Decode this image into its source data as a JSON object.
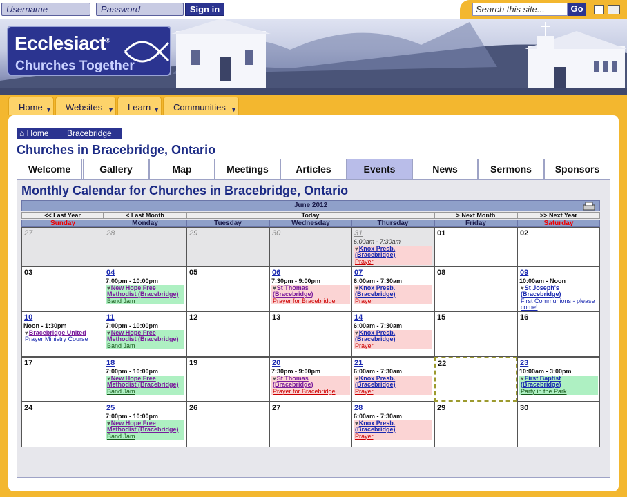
{
  "top": {
    "username_ph": "Username",
    "password_ph": "Password",
    "signin": "Sign in",
    "search_ph": "Search this site...",
    "go": "Go"
  },
  "logo": {
    "line1": "Ecclesiact",
    "reg": "®",
    "line2": "Churches Together"
  },
  "nav": [
    "Home",
    "Websites",
    "Learn",
    "Communities"
  ],
  "breadcrumb": {
    "home": "Home",
    "current": "Bracebridge"
  },
  "page_title": "Churches in Bracebridge, Ontario",
  "tabs": [
    "Welcome",
    "Gallery",
    "Map",
    "Meetings",
    "Articles",
    "Events",
    "News",
    "Sermons",
    "Sponsors"
  ],
  "active_tab": "Events",
  "calendar": {
    "title": "Monthly Calendar for Churches in Bracebridge, Ontario",
    "month": "June 2012",
    "nav": {
      "last_year": "<< Last Year",
      "last_month": "< Last Month",
      "today": "Today",
      "next_month": "> Next Month",
      "next_year": ">> Next Year"
    },
    "days": [
      "Sunday",
      "Monday",
      "Tuesday",
      "Wednesday",
      "Thursday",
      "Friday",
      "Saturday"
    ],
    "weeks": [
      [
        {
          "d": "27",
          "other": true
        },
        {
          "d": "28",
          "other": true
        },
        {
          "d": "29",
          "other": true
        },
        {
          "d": "30",
          "other": true
        },
        {
          "d": "31",
          "other": true,
          "link": true,
          "ev": {
            "time": "6:00am - 7:30am",
            "org": "Knox Presb. (Bracebridge)",
            "name": "Prayer",
            "c": "pink"
          }
        },
        {
          "d": "01"
        },
        {
          "d": "02"
        }
      ],
      [
        {
          "d": "03"
        },
        {
          "d": "04",
          "link": true,
          "ev": {
            "time": "7:00pm - 10:00pm",
            "org": "New Hope Free Methodist (Bracebridge)",
            "name": "Band Jam",
            "c": "green"
          }
        },
        {
          "d": "05"
        },
        {
          "d": "06",
          "link": true,
          "ev": {
            "time": "7:30pm - 9:00pm",
            "org": "St Thomas (Bracebridge)",
            "name": "Prayer for Bracebridge",
            "c": "pink"
          }
        },
        {
          "d": "07",
          "link": true,
          "ev": {
            "time": "6:00am - 7:30am",
            "org": "Knox Presb. (Bracebridge)",
            "name": "Prayer",
            "c": "pink"
          }
        },
        {
          "d": "08"
        },
        {
          "d": "09",
          "link": true,
          "ev": {
            "time": "10:00am - Noon",
            "org": "St Joseph's (Bracebridge)",
            "name": "First Communions - please come!",
            "c": "blue"
          }
        }
      ],
      [
        {
          "d": "10",
          "link": true,
          "ev": {
            "time": "Noon - 1:30pm",
            "org": "Bracebridge United",
            "name": "Prayer Ministry Course",
            "c": "blue"
          }
        },
        {
          "d": "11",
          "link": true,
          "ev": {
            "time": "7:00pm - 10:00pm",
            "org": "New Hope Free Methodist (Bracebridge)",
            "name": "Band Jam",
            "c": "green"
          }
        },
        {
          "d": "12"
        },
        {
          "d": "13"
        },
        {
          "d": "14",
          "link": true,
          "ev": {
            "time": "6:00am - 7:30am",
            "org": "Knox Presb. (Bracebridge)",
            "name": "Prayer",
            "c": "pink"
          }
        },
        {
          "d": "15"
        },
        {
          "d": "16"
        }
      ],
      [
        {
          "d": "17"
        },
        {
          "d": "18",
          "link": true,
          "ev": {
            "time": "7:00pm - 10:00pm",
            "org": "New Hope Free Methodist (Bracebridge)",
            "name": "Band Jam",
            "c": "green"
          }
        },
        {
          "d": "19"
        },
        {
          "d": "20",
          "link": true,
          "ev": {
            "time": "7:30pm - 9:00pm",
            "org": "St Thomas (Bracebridge)",
            "name": "Prayer for Bracebridge",
            "c": "pink"
          }
        },
        {
          "d": "21",
          "link": true,
          "ev": {
            "time": "6:00am - 7:30am",
            "org": "Knox Presb. (Bracebridge)",
            "name": "Prayer",
            "c": "pink"
          }
        },
        {
          "d": "22",
          "today": true
        },
        {
          "d": "23",
          "link": true,
          "ev": {
            "time": "10:00am - 3:00pm",
            "org": "First Baptist (Bracebridge)",
            "name": "Party in the Park",
            "c": "green"
          }
        }
      ],
      [
        {
          "d": "24"
        },
        {
          "d": "25",
          "link": true,
          "ev": {
            "time": "7:00pm - 10:00pm",
            "org": "New Hope Free Methodist (Bracebridge)",
            "name": "Band Jam",
            "c": "green"
          }
        },
        {
          "d": "26"
        },
        {
          "d": "27"
        },
        {
          "d": "28",
          "link": true,
          "ev": {
            "time": "6:00am - 7:30am",
            "org": "Knox Presb. (Bracebridge)",
            "name": "Prayer",
            "c": "pink"
          }
        },
        {
          "d": "29"
        },
        {
          "d": "30"
        }
      ]
    ]
  }
}
